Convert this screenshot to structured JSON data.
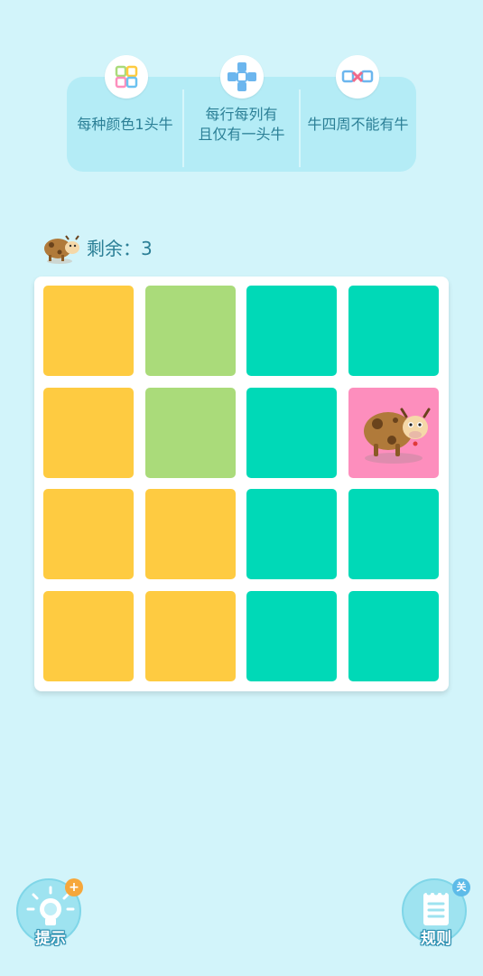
{
  "rules": [
    {
      "text_lines": [
        "每种颜色1头牛"
      ],
      "icon": "color-grid-icon"
    },
    {
      "text_lines": [
        "每行每列有",
        "且仅有一头牛"
      ],
      "icon": "row-column-icon"
    },
    {
      "text_lines": [
        "牛四周不能有牛"
      ],
      "icon": "no-adjacent-icon"
    }
  ],
  "remaining": {
    "label": "剩余：3",
    "icon": "cow-icon"
  },
  "board": {
    "rows": 4,
    "cols": 4,
    "colors": {
      "yellow": "#fecb41",
      "green": "#aadb7a",
      "teal": "#00d9b7",
      "pink": "#fd8ebd"
    },
    "cells": [
      [
        "yellow",
        "green",
        "teal",
        "teal"
      ],
      [
        "yellow",
        "green",
        "teal",
        "pink"
      ],
      [
        "yellow",
        "yellow",
        "teal",
        "teal"
      ],
      [
        "yellow",
        "yellow",
        "teal",
        "teal"
      ]
    ],
    "cows": [
      [
        1,
        3
      ]
    ]
  },
  "buttons": {
    "hint": {
      "label": "提示",
      "icon": "lightbulb-icon",
      "badge": "+"
    },
    "rules": {
      "label": "规则",
      "icon": "notepad-icon",
      "badge": "关"
    }
  }
}
